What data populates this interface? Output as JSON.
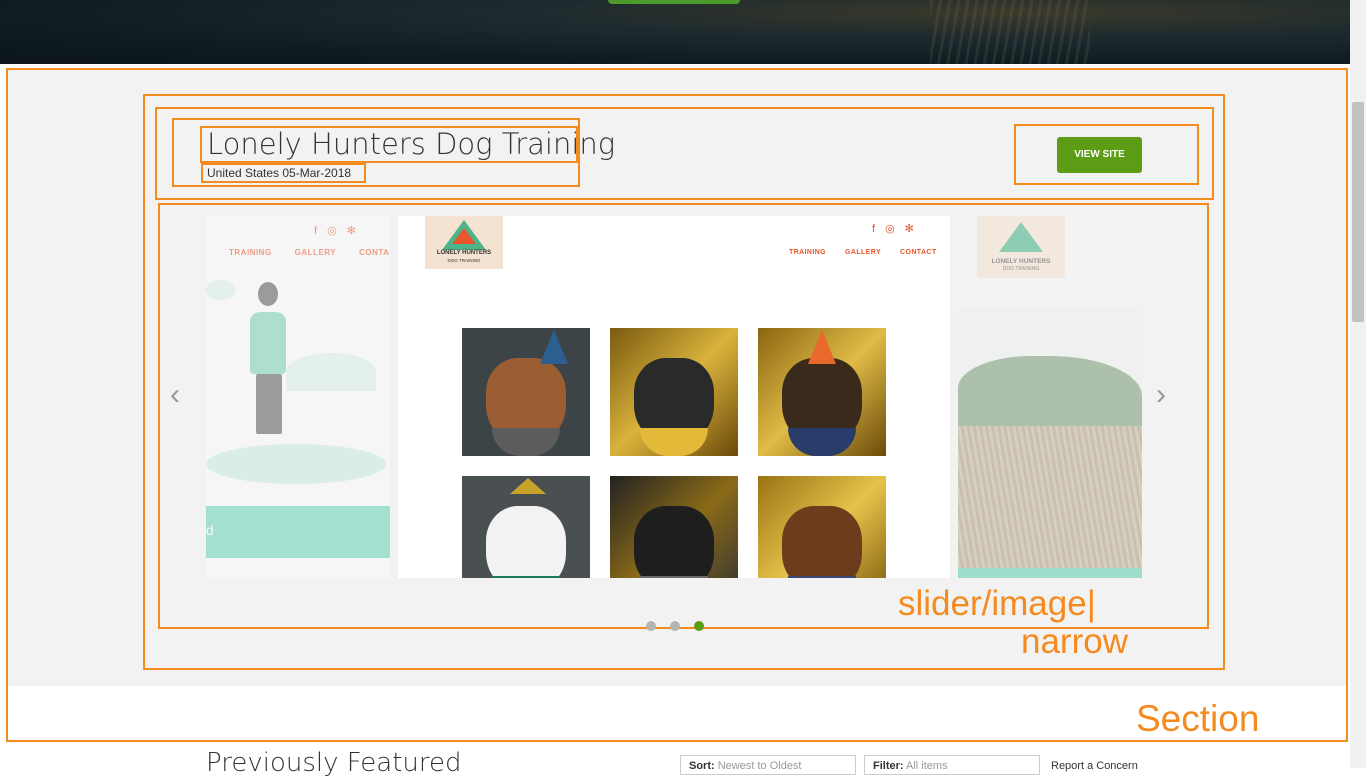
{
  "annotations": {
    "section_label": "Section",
    "slider_label_line1": "slider/image|",
    "slider_label_line2": "narrow"
  },
  "site": {
    "title": "Lonely Hunters Dog Training",
    "subline": "United States 05-Mar-2018",
    "view_button": "VIEW SITE"
  },
  "slider": {
    "prev_arrow": "‹",
    "next_arrow": "›",
    "dots_count": 3,
    "active_dot": 3,
    "left_slide": {
      "nav": [
        "TRAINING",
        "GALLERY",
        "CONTACT"
      ],
      "band_text": "d"
    },
    "center_slide": {
      "logo_line1": "LONELY HUNTERS",
      "logo_line2": "DOG TRAINING",
      "nav": [
        "TRAINING",
        "GALLERY",
        "CONTACT"
      ],
      "social_icons": [
        "facebook-icon",
        "instagram-icon",
        "yelp-icon"
      ]
    },
    "right_slide": {
      "logo_line1": "LONELY HUNTERS",
      "logo_line2": "DOG TRAINING"
    }
  },
  "below": {
    "heading": "Previously Featured",
    "sort_label": "Sort:",
    "sort_value": "Newest to Oldest",
    "filter_label": "Filter:",
    "filter_value": "All items",
    "report": "Report a Concern"
  },
  "colors": {
    "annotation": "#f58a1f",
    "button": "#5d9d16",
    "brand_orange": "#e8552a",
    "mint": "#66d2b4"
  }
}
